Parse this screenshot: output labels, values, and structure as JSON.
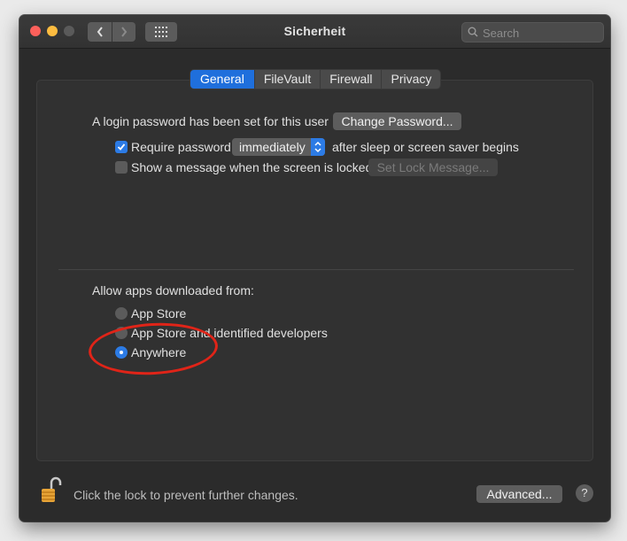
{
  "window": {
    "title": "Sicherheit"
  },
  "toolbar": {
    "back_icon": "chevron-left-icon",
    "forward_icon": "chevron-right-icon",
    "grid_icon": "grid-icon",
    "search_placeholder": "Search"
  },
  "tabs": [
    {
      "label": "General",
      "active": true
    },
    {
      "label": "FileVault",
      "active": false
    },
    {
      "label": "Firewall",
      "active": false
    },
    {
      "label": "Privacy",
      "active": false
    }
  ],
  "general": {
    "login_text": "A login password has been set for this user",
    "change_password_label": "Change Password...",
    "require_password": {
      "label": "Require password",
      "checked": true,
      "value": "immediately",
      "suffix": "after sleep or screen saver begins"
    },
    "show_message": {
      "label": "Show a message when the screen is locked",
      "checked": false,
      "button_label": "Set Lock Message..."
    },
    "allow_apps_label": "Allow apps downloaded from:",
    "allow_apps_options": [
      {
        "label": "App Store",
        "selected": false
      },
      {
        "label": "App Store and identified developers",
        "selected": false
      },
      {
        "label": "Anywhere",
        "selected": true
      }
    ]
  },
  "footer": {
    "lock_text": "Click the lock to prevent further changes.",
    "advanced_label": "Advanced...",
    "help_label": "?"
  },
  "colors": {
    "accent": "#2c7be5",
    "annotation": "#e02418"
  }
}
